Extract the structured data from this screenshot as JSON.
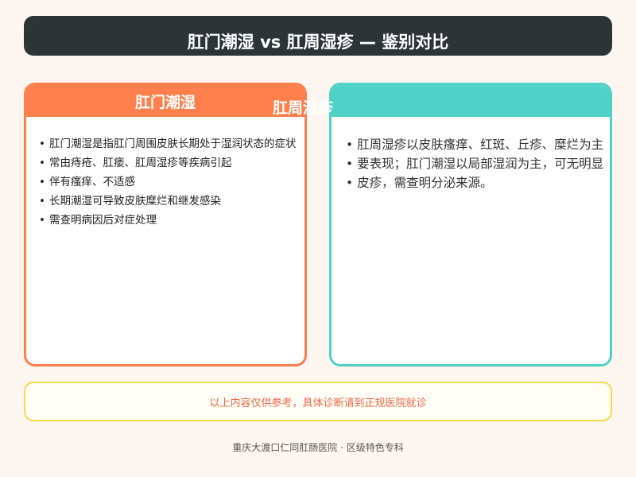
{
  "header": {
    "title": "肛门潮湿 vs 肛周湿疹 — 鉴别对比"
  },
  "left_card": {
    "title": "肛门潮湿",
    "bullet": "•",
    "items": [
      "肛门潮湿是指肛门周围皮肤长期处于湿润状态的症状",
      "常由痔疮、肛瘘、肛周湿疹等疾病引起",
      "伴有瘙痒、不适感",
      "长期潮湿可导致皮肤糜烂和继发感染",
      "需查明病因后对症处理"
    ]
  },
  "right_card": {
    "title": "肛周湿疹",
    "bullet": "•",
    "items": [
      "肛周湿疹以皮肤瘙痒、红斑、丘疹、糜烂为主",
      "要表现；肛门潮湿以局部湿润为主，可无明显",
      "皮疹，需查明分泌来源。"
    ]
  },
  "notice": {
    "text": "以上内容仅供参考，具体诊断请到正规医院就诊"
  },
  "footer": {
    "text": "重庆大渡口仁同肛肠医院 · 区级特色专科"
  },
  "colors": {
    "header_bg": "#2d3436",
    "left_accent": "#ff7f4d",
    "right_accent": "#4fd1c5",
    "notice_border": "#f9d94a",
    "notice_text": "#e86a4a"
  }
}
